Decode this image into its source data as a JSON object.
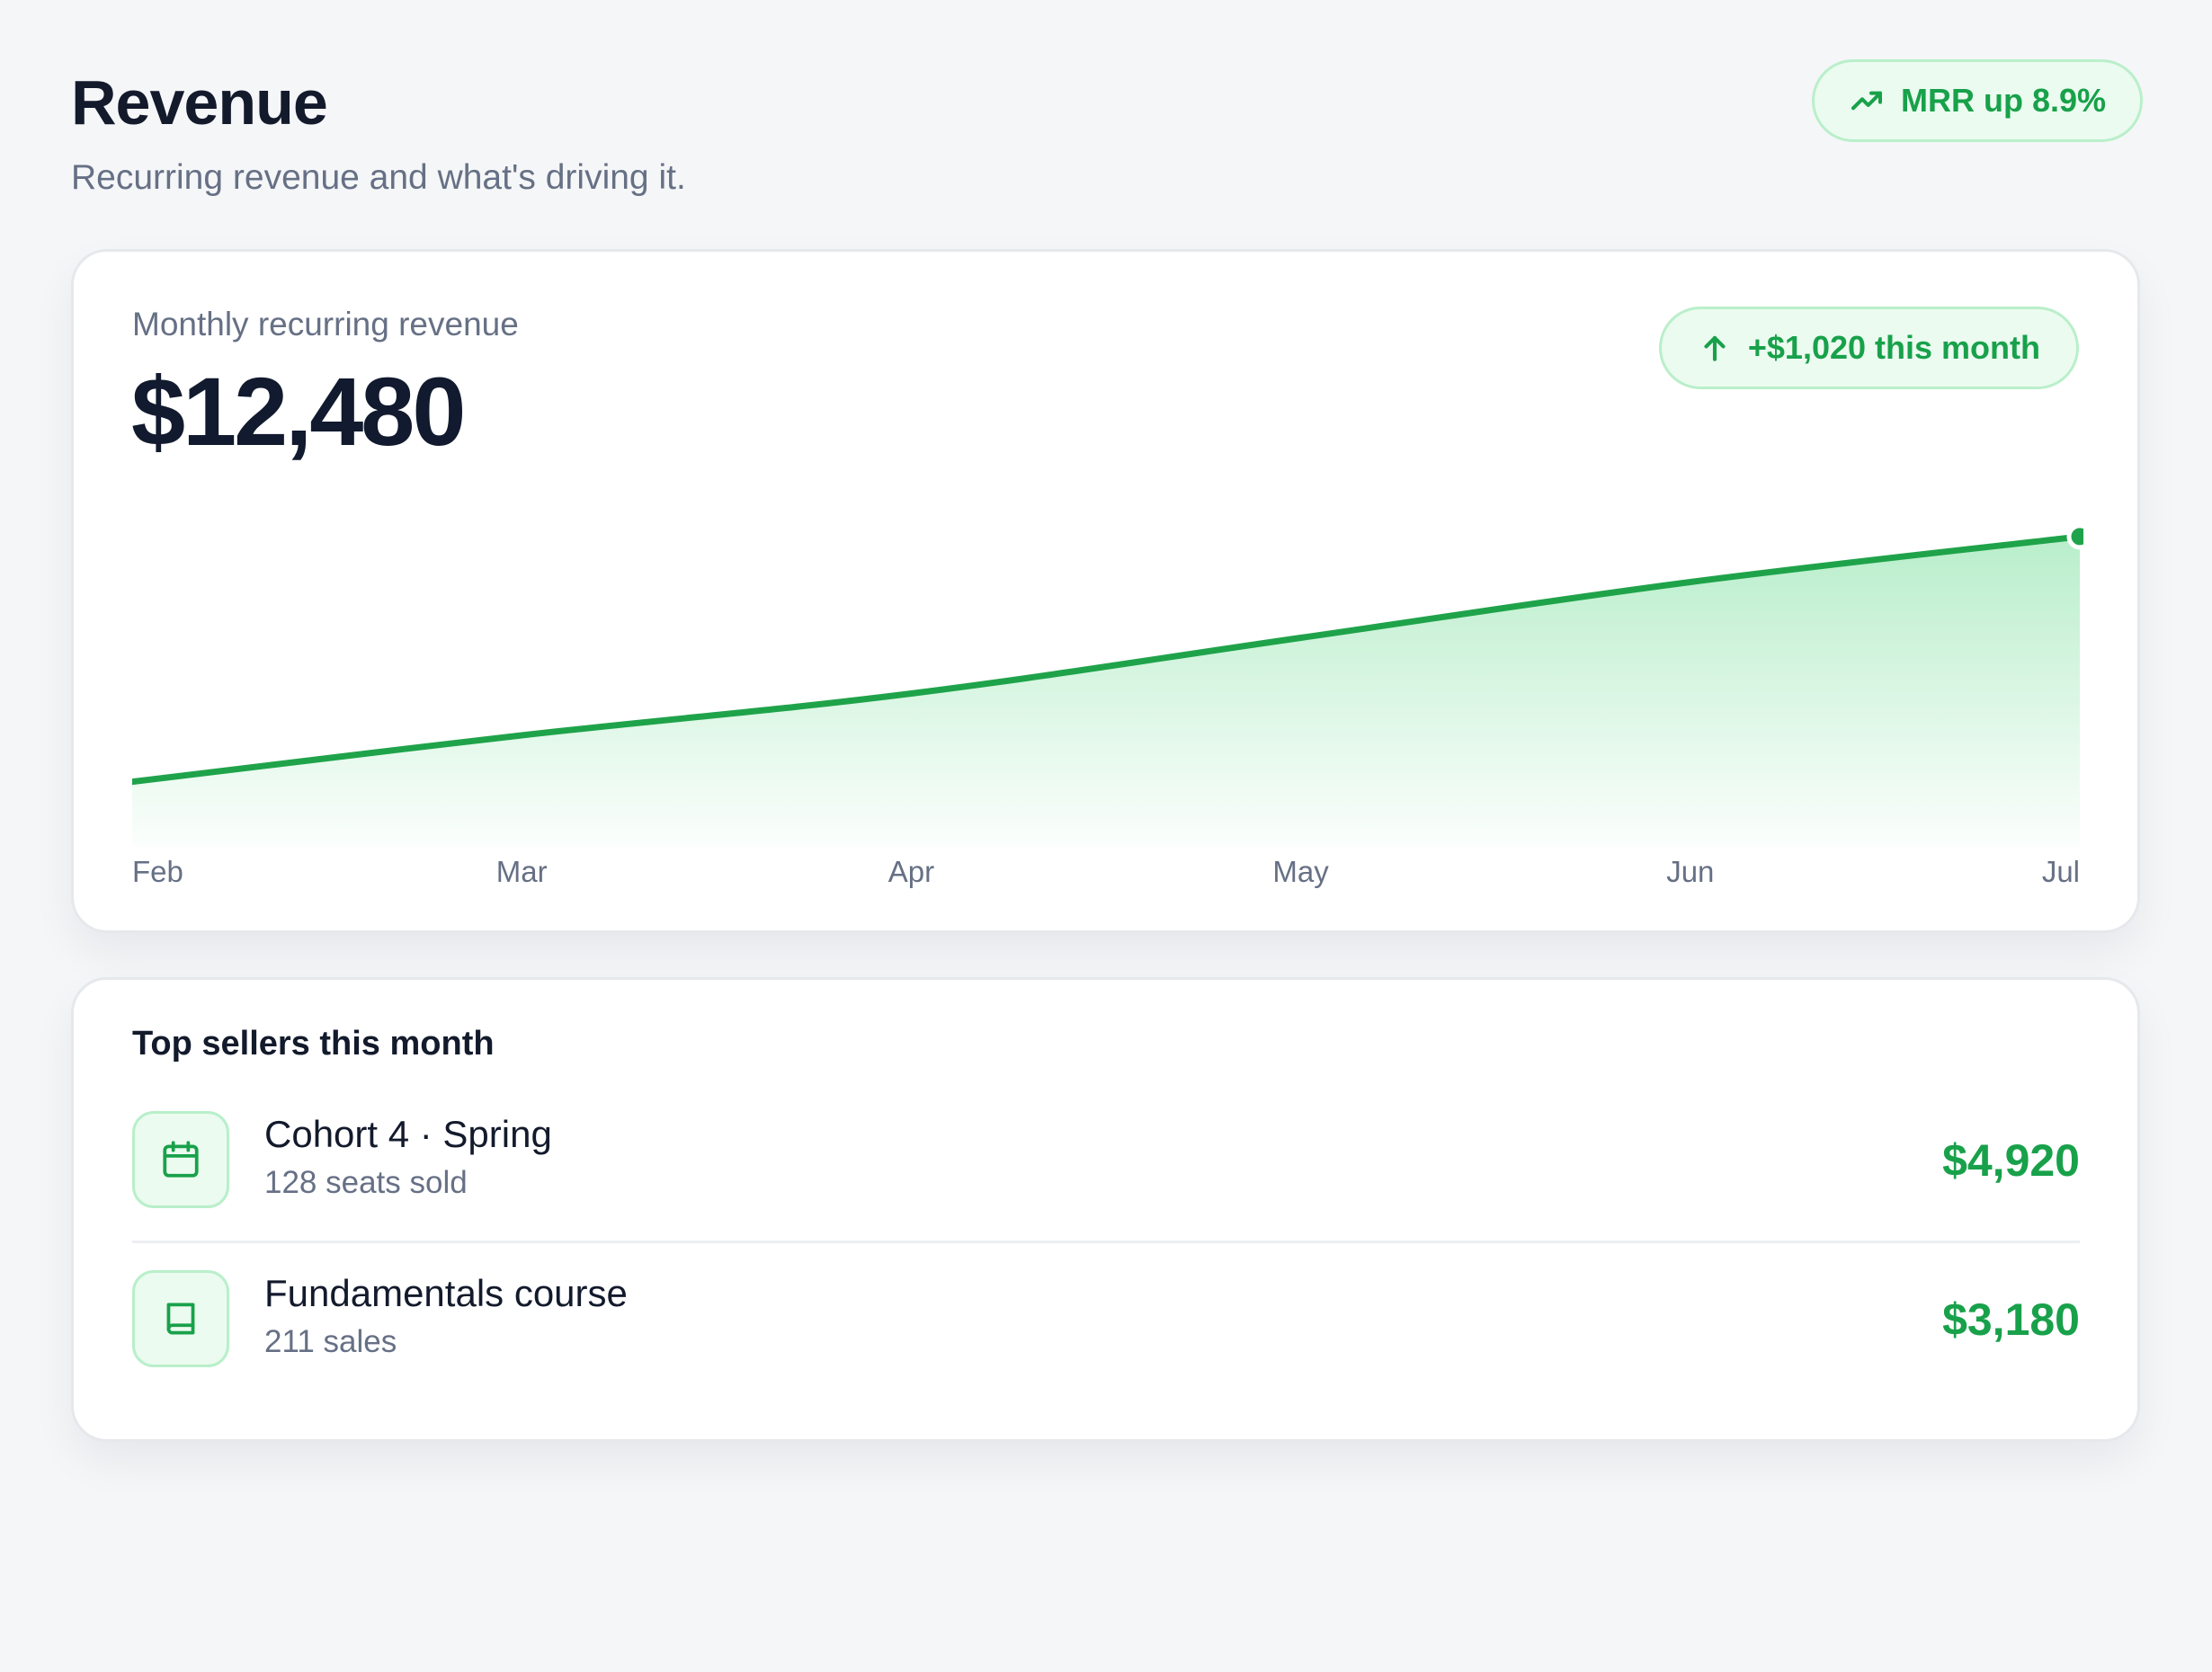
{
  "header": {
    "title": "Revenue",
    "subtitle": "Recurring revenue and what's driving it.",
    "badge": "MRR up 8.9%",
    "badge_icon": "trending-up-icon"
  },
  "mrr_card": {
    "label": "Monthly recurring revenue",
    "value": "$12,480",
    "delta_badge": "+$1,020 this month",
    "delta_icon": "arrow-up-icon"
  },
  "chart_data": {
    "type": "area",
    "categories": [
      "Feb",
      "Mar",
      "Apr",
      "May",
      "Jun",
      "Jul"
    ],
    "x": [
      "Feb",
      "Mar",
      "Apr",
      "May",
      "Jun",
      "Jul"
    ],
    "values": [
      7200,
      8200,
      9100,
      10300,
      11500,
      12480
    ],
    "ylim": [
      5800,
      13000
    ],
    "grid": false,
    "color": "#1fa34a",
    "title": "",
    "xlabel": "",
    "ylabel": ""
  },
  "sellers": {
    "title": "Top sellers this month",
    "items": [
      {
        "name": "Cohort 4 · Spring",
        "meta": "128 seats sold",
        "amount": "$4,920",
        "icon": "calendar-icon"
      },
      {
        "name": "Fundamentals course",
        "meta": "211 sales",
        "amount": "$3,180",
        "icon": "book-icon"
      }
    ]
  },
  "colors": {
    "accent": "#18a14a",
    "accent_bg": "#ebfbf0",
    "accent_border": "#b9efca",
    "text": "#131a2c",
    "muted": "#667085",
    "background": "#f5f6f8"
  }
}
